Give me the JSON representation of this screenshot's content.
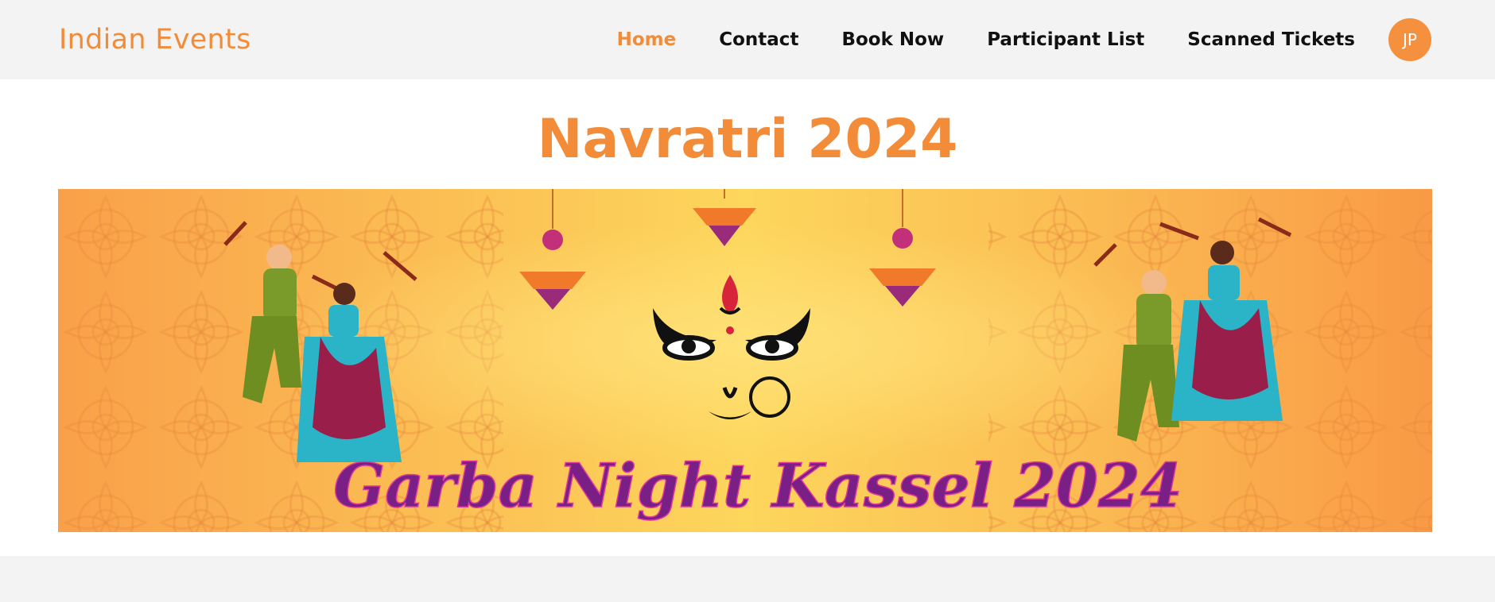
{
  "navbar": {
    "brand": "Indian Events",
    "links": [
      {
        "label": "Home",
        "active": true
      },
      {
        "label": "Contact",
        "active": false
      },
      {
        "label": "Book Now",
        "active": false
      },
      {
        "label": "Participant List",
        "active": false
      },
      {
        "label": "Scanned Tickets",
        "active": false
      }
    ],
    "avatar_initials": "JP"
  },
  "main": {
    "title": "Navratri 2024",
    "banner": {
      "headline": "Garba Night Kassel 2024",
      "theme_colors": {
        "orange": "#f7a24a",
        "yellow": "#fdd25a",
        "purple": "#7a1f86",
        "accent": "#f28c38"
      }
    }
  }
}
